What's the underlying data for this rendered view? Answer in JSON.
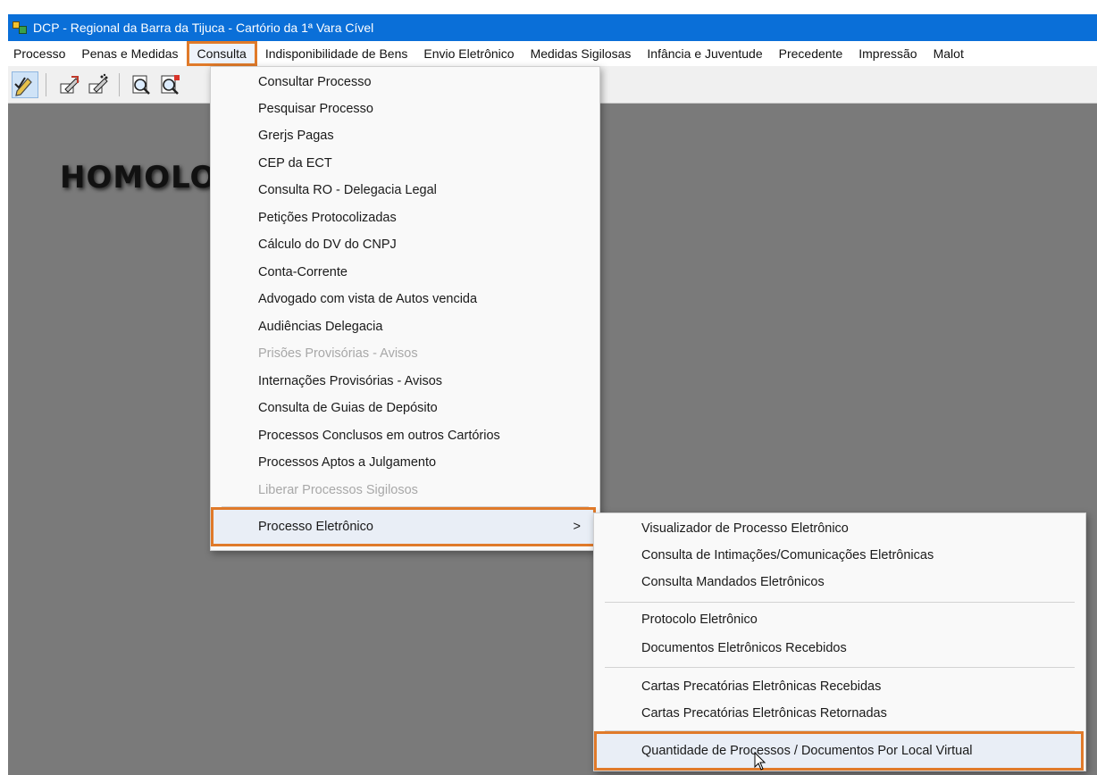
{
  "window": {
    "title": "DCP - Regional da Barra da Tijuca - Cartório da 1ª Vara Cível"
  },
  "menubar": {
    "items": [
      "Processo",
      "Penas e Medidas",
      "Consulta",
      "Indisponibilidade de Bens",
      "Envio Eletrônico",
      "Medidas Sigilosas",
      "Infância e Juventude",
      "Precedente",
      "Impressão",
      "Malot"
    ],
    "active": "Consulta"
  },
  "workspace": {
    "watermark": "HOMOLO"
  },
  "consulta_menu": {
    "items": [
      {
        "label": "Consultar Processo",
        "enabled": true
      },
      {
        "label": "Pesquisar Processo",
        "enabled": true
      },
      {
        "label": "Grerjs Pagas",
        "enabled": true
      },
      {
        "label": "CEP da ECT",
        "enabled": true
      },
      {
        "label": "Consulta RO - Delegacia Legal",
        "enabled": true
      },
      {
        "label": "Petições Protocolizadas",
        "enabled": true
      },
      {
        "label": "Cálculo do DV do CNPJ",
        "enabled": true
      },
      {
        "label": "Conta-Corrente",
        "enabled": true
      },
      {
        "label": "Advogado com vista de Autos vencida",
        "enabled": true
      },
      {
        "label": "Audiências Delegacia",
        "enabled": true
      },
      {
        "label": "Prisões Provisórias - Avisos",
        "enabled": false
      },
      {
        "label": "Internações Provisórias - Avisos",
        "enabled": true
      },
      {
        "label": "Consulta de Guias de Depósito",
        "enabled": true
      },
      {
        "label": "Processos Conclusos em outros Cartórios",
        "enabled": true
      },
      {
        "label": "Processos Aptos a Julgamento",
        "enabled": true
      },
      {
        "label": "Liberar Processos Sigilosos",
        "enabled": false
      },
      {
        "label": "Processo Eletrônico",
        "enabled": true,
        "submenu_arrow": ">"
      }
    ]
  },
  "processo_eletronico_submenu": {
    "items": [
      "Visualizador de Processo Eletrônico",
      "Consulta de Intimações/Comunicações Eletrônicas",
      "Consulta Mandados Eletrônicos",
      "Protocolo Eletrônico",
      "Documentos Eletrônicos Recebidos",
      "Cartas Precatórias Eletrônicas Recebidas",
      "Cartas Precatórias Eletrônicas Retornadas",
      "Quantidade de Processos / Documentos Por Local Virtual"
    ]
  },
  "colors": {
    "titlebar": "#0a6fd8",
    "highlight_border": "#e07a2a",
    "workspace": "#7a7a7a"
  },
  "toolbar": {
    "icons": [
      "edit-check-icon",
      "pen-arrow-icon",
      "pen-stars-icon",
      "magnify-page-icon",
      "magnify-doc-icon"
    ]
  }
}
